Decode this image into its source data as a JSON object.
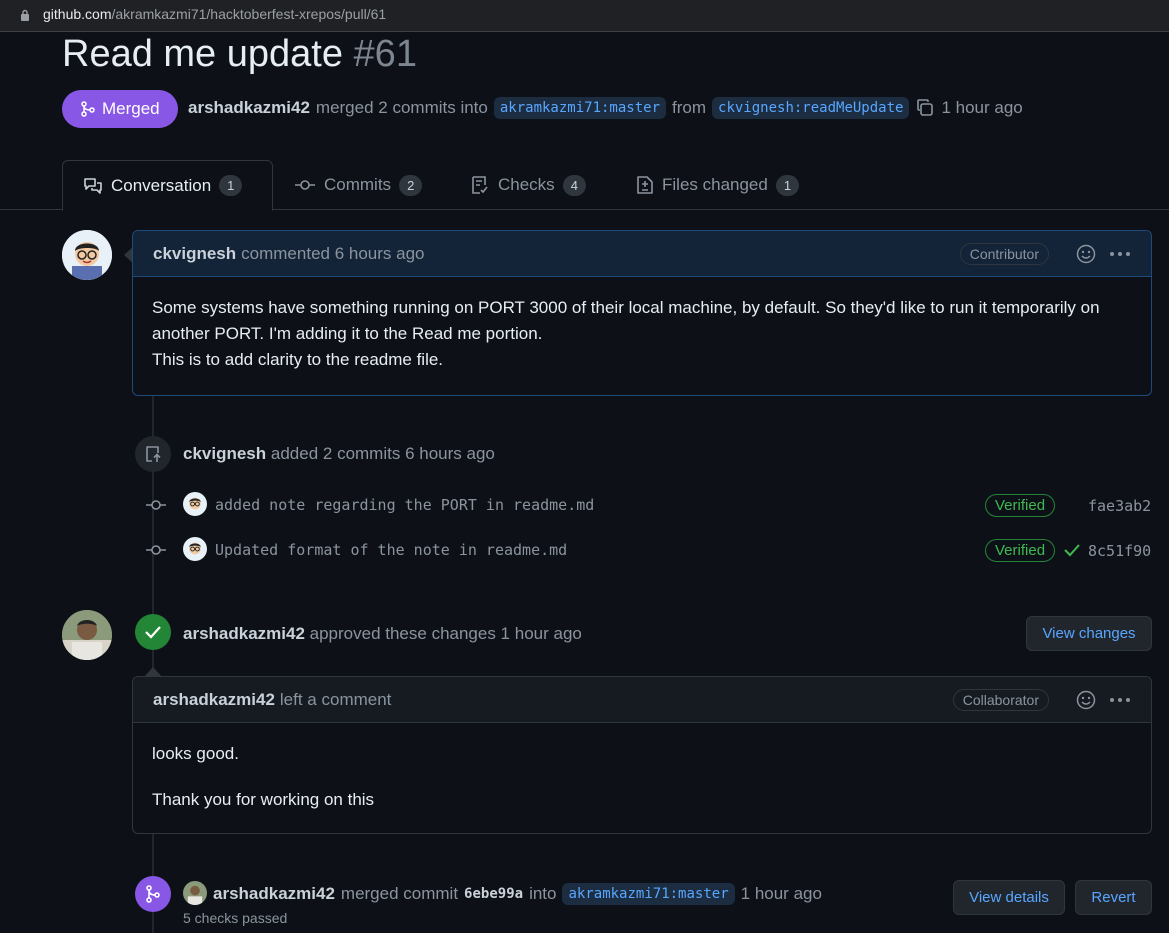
{
  "browser": {
    "url_host": "github.com",
    "url_path": "/akramkazmi71/hacktoberfest-xrepos/pull/61"
  },
  "pr": {
    "title": "Read me update",
    "number": "#61",
    "state": "Merged",
    "author": "arshadkazmi42",
    "merged_text": "merged 2 commits into",
    "base_branch": "akramkazmi71:master",
    "from_text": "from",
    "head_branch": "ckvignesh:readMeUpdate",
    "time": "1 hour ago"
  },
  "tabs": [
    {
      "label": "Conversation",
      "count": "1",
      "icon": "comment-discussion-icon"
    },
    {
      "label": "Commits",
      "count": "2",
      "icon": "git-commit-icon"
    },
    {
      "label": "Checks",
      "count": "4",
      "icon": "checklist-icon"
    },
    {
      "label": "Files changed",
      "count": "1",
      "icon": "file-diff-icon"
    }
  ],
  "comment1": {
    "author": "ckvignesh",
    "action": "commented 6 hours ago",
    "role": "Contributor",
    "body_line1": "Some systems have something running on PORT 3000 of their local machine, by default. So they'd like to run it temporarily on",
    "body_line2": "another PORT. I'm adding it to the Read me portion.",
    "body_line3": "This is to add clarity to the readme file."
  },
  "commits_event": {
    "author": "ckvignesh",
    "text": "added 2 commits 6 hours ago",
    "commits": [
      {
        "message": "added note regarding the PORT in readme.md",
        "verified": "Verified",
        "sha": "fae3ab2"
      },
      {
        "message": "Updated format of the note in readme.md",
        "verified": "Verified",
        "sha": "8c51f90"
      }
    ]
  },
  "review": {
    "author": "arshadkazmi42",
    "text": "approved these changes 1 hour ago",
    "view_changes": "View changes",
    "comment_author": "arshadkazmi42",
    "comment_action": "left a comment",
    "role": "Collaborator",
    "body_line1": "looks good.",
    "body_line2": "Thank you for working on this"
  },
  "merge_event": {
    "author": "arshadkazmi42",
    "text1": "merged commit",
    "sha": "6ebe99a",
    "text2": "into",
    "branch": "akramkazmi71:master",
    "time": "1 hour ago",
    "checks": "5 checks passed",
    "view_details": "View details",
    "revert": "Revert"
  },
  "colors": {
    "merged": "#8957e5",
    "approved": "#238636",
    "link": "#58a6ff",
    "background": "#0d1117"
  }
}
